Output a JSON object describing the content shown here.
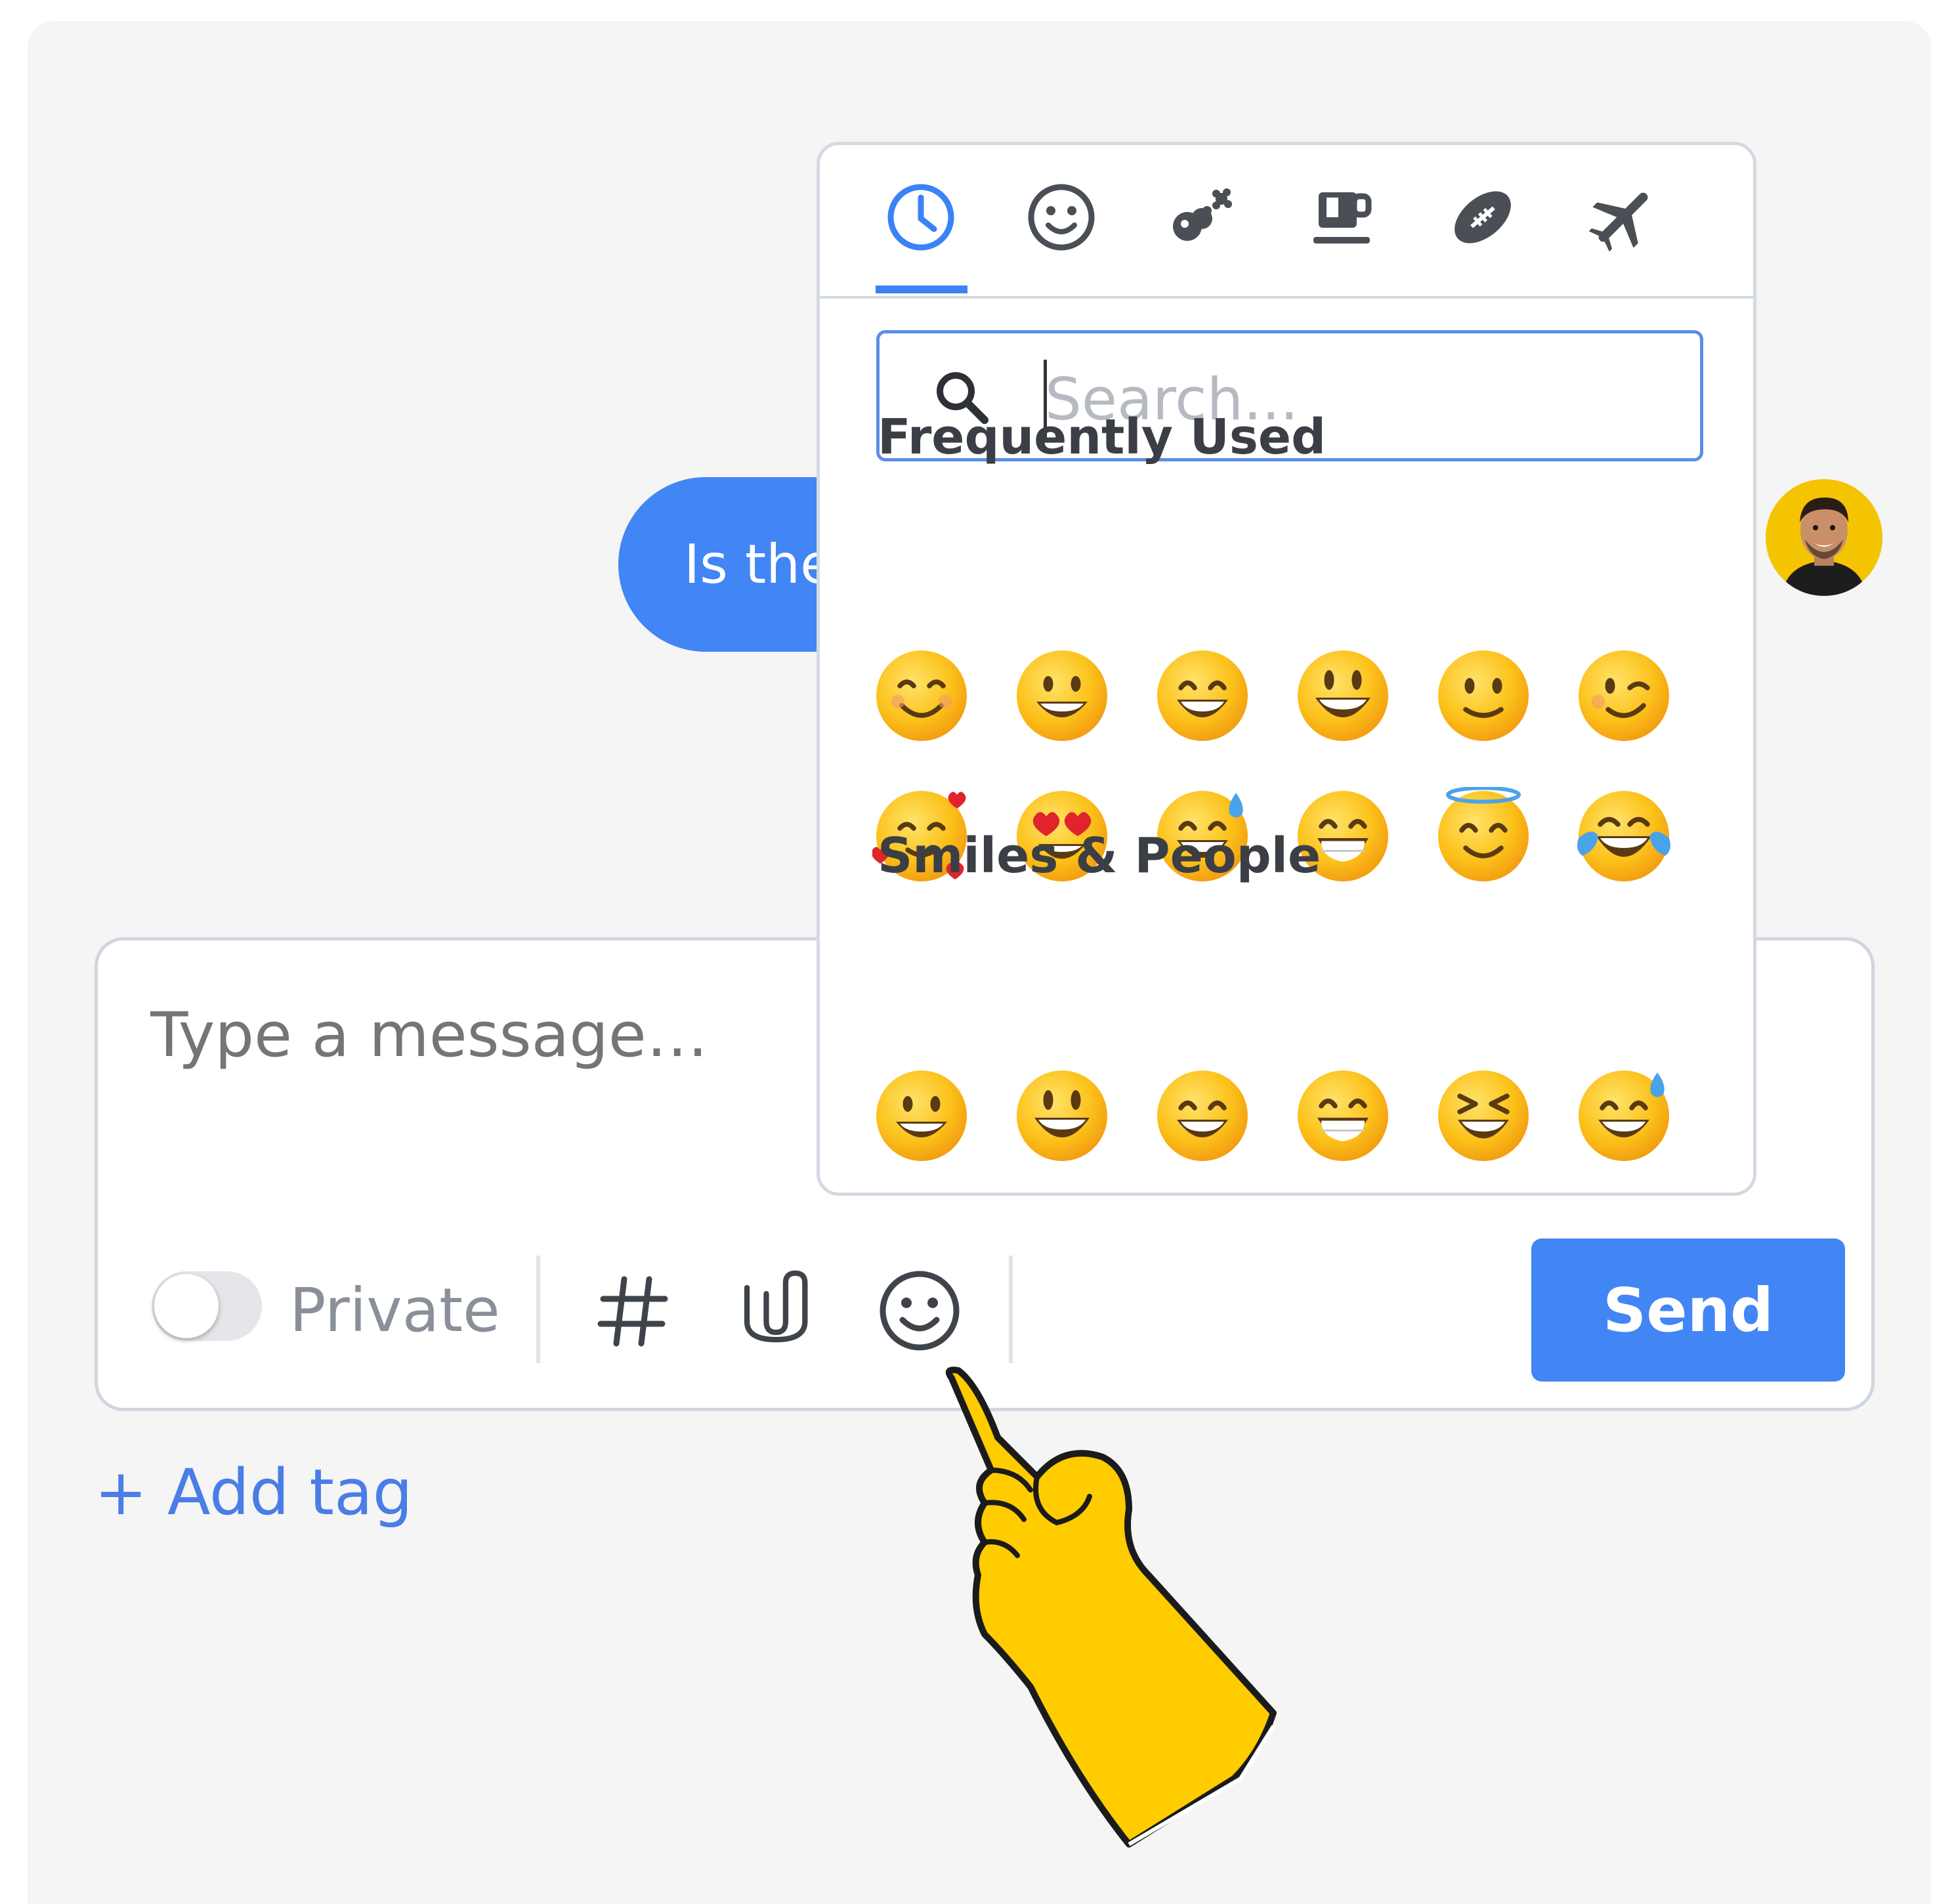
{
  "chat": {
    "bubble_text": "Is the"
  },
  "composer": {
    "placeholder": "Type a message…",
    "private_label": "Private",
    "private_enabled": false,
    "send_label": "Send",
    "add_tag_label": "+ Add tag",
    "tools": [
      {
        "icon": "hash-icon"
      },
      {
        "icon": "paperclip-icon"
      },
      {
        "icon": "smiley-icon"
      }
    ]
  },
  "emoji_picker": {
    "active_tab": 0,
    "tabs": [
      {
        "icon": "clock-icon",
        "category": "recent"
      },
      {
        "icon": "smiley-icon",
        "category": "smileys"
      },
      {
        "icon": "flower-icon",
        "category": "nature"
      },
      {
        "icon": "coffee-icon",
        "category": "food"
      },
      {
        "icon": "football-icon",
        "category": "activities"
      },
      {
        "icon": "airplane-icon",
        "category": "travel"
      }
    ],
    "search_placeholder": "Search...",
    "sections": [
      {
        "title": "Frequently Used",
        "emojis": [
          "smiling-eyes",
          "grinning",
          "grinning-eyes",
          "big-smile",
          "slight-smile",
          "wink",
          "hearts-face",
          "heart-eyes",
          "sweat-smile",
          "beaming",
          "halo",
          "tears-of-joy"
        ]
      },
      {
        "title": "Smiles & People",
        "emojis": [
          "grinning",
          "big-smile",
          "grinning-eyes",
          "beaming",
          "squinting",
          "sweat-smile"
        ]
      }
    ]
  },
  "colors": {
    "accent": "#4285f4",
    "emoji_yellow": "#fcc21b",
    "avatar_bg": "#f5c400",
    "hand_yellow": "#ffcc00"
  }
}
